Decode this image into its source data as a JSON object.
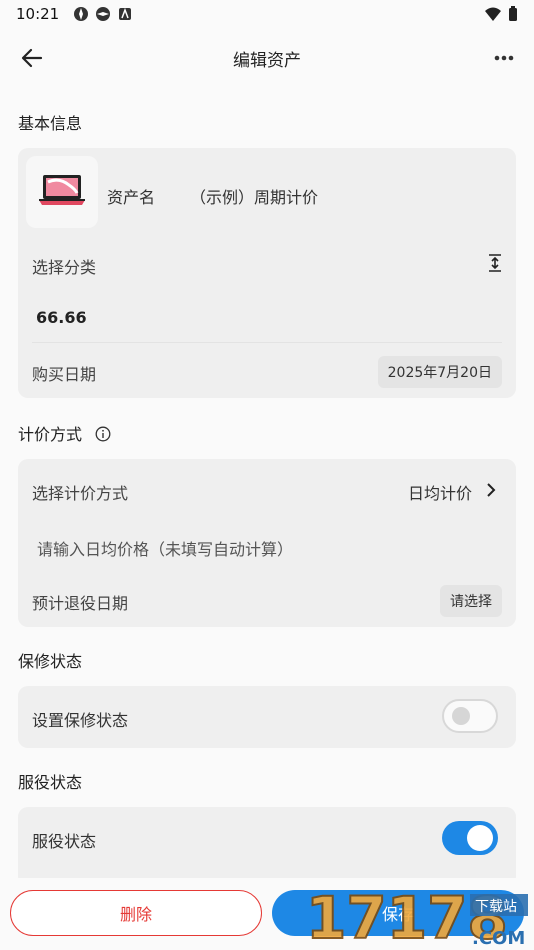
{
  "status_bar": {
    "time": "10:21"
  },
  "appbar": {
    "title": "编辑资产"
  },
  "basic_info": {
    "section_title": "基本信息",
    "asset_name_label": "资产名",
    "asset_name_value": "（示例）周期计价",
    "category_label": "选择分类",
    "price_value": "66.66",
    "purchase_date_label": "购买日期",
    "purchase_date_value": "2025年7月20日"
  },
  "pricing": {
    "section_title": "计价方式",
    "method_label": "选择计价方式",
    "method_value": "日均计价",
    "daily_price_placeholder": "请输入日均价格（未填写自动计算）",
    "retire_date_label": "预计退役日期",
    "retire_date_value": "请选择"
  },
  "warranty": {
    "section_title": "保修状态",
    "toggle_label": "设置保修状态",
    "toggle_on": false
  },
  "service": {
    "section_title": "服役状态",
    "toggle_label": "服役状态",
    "toggle_on": true
  },
  "actions": {
    "delete_label": "删除",
    "save_label": "保存"
  },
  "watermark": {
    "text": "17178",
    "sub": "下载站",
    "domain": ".COM"
  },
  "colors": {
    "accent": "#1e88e5",
    "danger": "#e53935",
    "card_bg": "#efefef"
  }
}
